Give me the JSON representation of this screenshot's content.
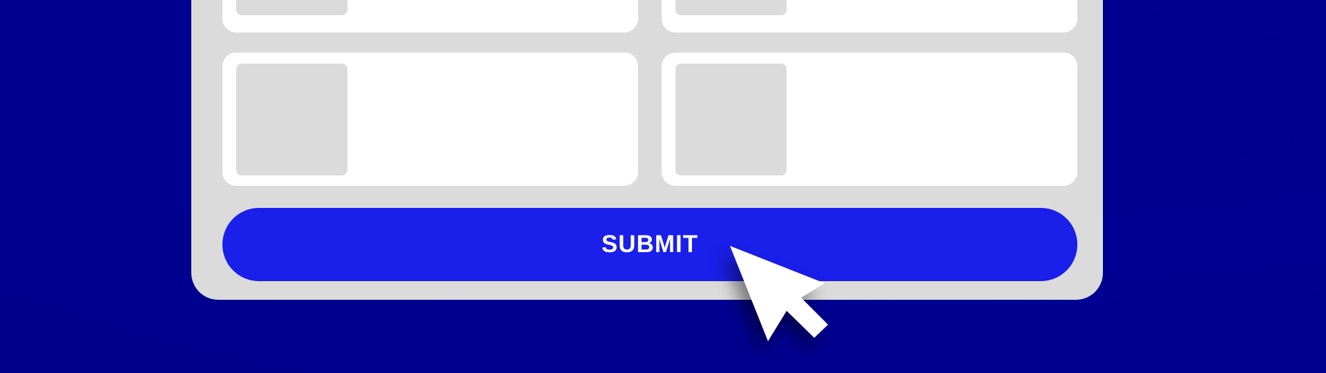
{
  "submit_button": {
    "label": "SUBMIT"
  },
  "colors": {
    "background": "#00008f",
    "panel": "#dbdbdb",
    "card": "#ffffff",
    "thumbnail": "#dbdbdb",
    "button": "#1a1fea",
    "button_text": "#ffffff",
    "cursor": "#ffffff"
  },
  "icons": {
    "cursor": "arrow-cursor-icon"
  }
}
